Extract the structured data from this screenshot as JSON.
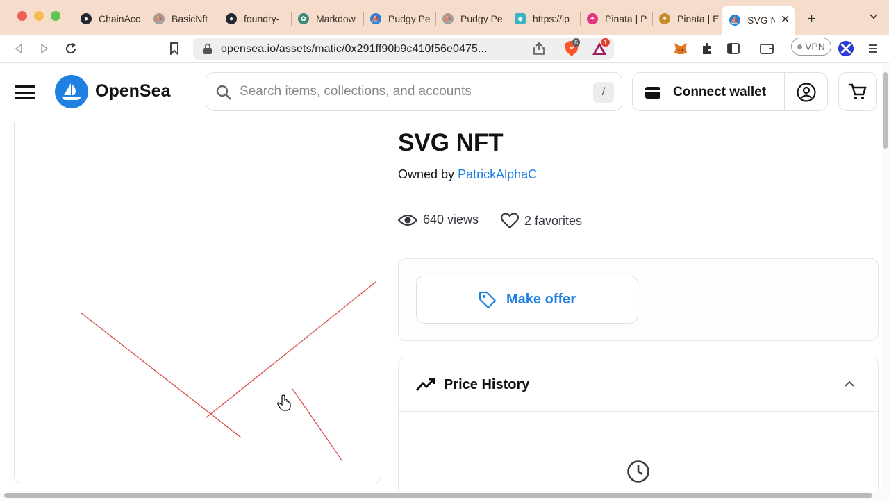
{
  "browser": {
    "tabs": [
      {
        "label": "ChainAcc",
        "icon": "github-icon",
        "color": "#24292f"
      },
      {
        "label": "BasicNft",
        "icon": "opensea-icon",
        "color": "#9e9e9e"
      },
      {
        "label": "foundry-",
        "icon": "github-icon",
        "color": "#24292f"
      },
      {
        "label": "Markdow",
        "icon": "chatgpt-icon",
        "color": "#3d8a76"
      },
      {
        "label": "Pudgy Pe",
        "icon": "opensea-icon",
        "color": "#2081e2"
      },
      {
        "label": "Pudgy Pe",
        "icon": "opensea-icon",
        "color": "#9e9e9e"
      },
      {
        "label": "https://ip",
        "icon": "cube-icon",
        "color": "#3bb3c3"
      },
      {
        "label": "Pinata | P",
        "icon": "pinata-icon",
        "color": "#e2367f"
      },
      {
        "label": "Pinata | E",
        "icon": "pinata-icon",
        "color": "#c78c27"
      },
      {
        "label": "SVG N",
        "icon": "opensea-icon",
        "color": "#2081e2"
      }
    ],
    "url": "opensea.io/assets/matic/0x291ff90b9c410f56e0475...",
    "brave_badge": "6",
    "rewards_badge": "1",
    "vpn_label": "VPN"
  },
  "header": {
    "brand": "OpenSea",
    "search_placeholder": "Search items, collections, and accounts",
    "search_shortcut": "/",
    "connect_label": "Connect wallet"
  },
  "asset": {
    "title": "SVG NFT",
    "owned_prefix": "Owned by",
    "owner": "PatrickAlphaC",
    "views": "640 views",
    "favorites": "2 favorites",
    "offer_label": "Make offer",
    "price_history_label": "Price History"
  },
  "colors": {
    "accent": "#2081e2",
    "nft_line": "#d64541",
    "tab_bar": "#f6dccb"
  }
}
